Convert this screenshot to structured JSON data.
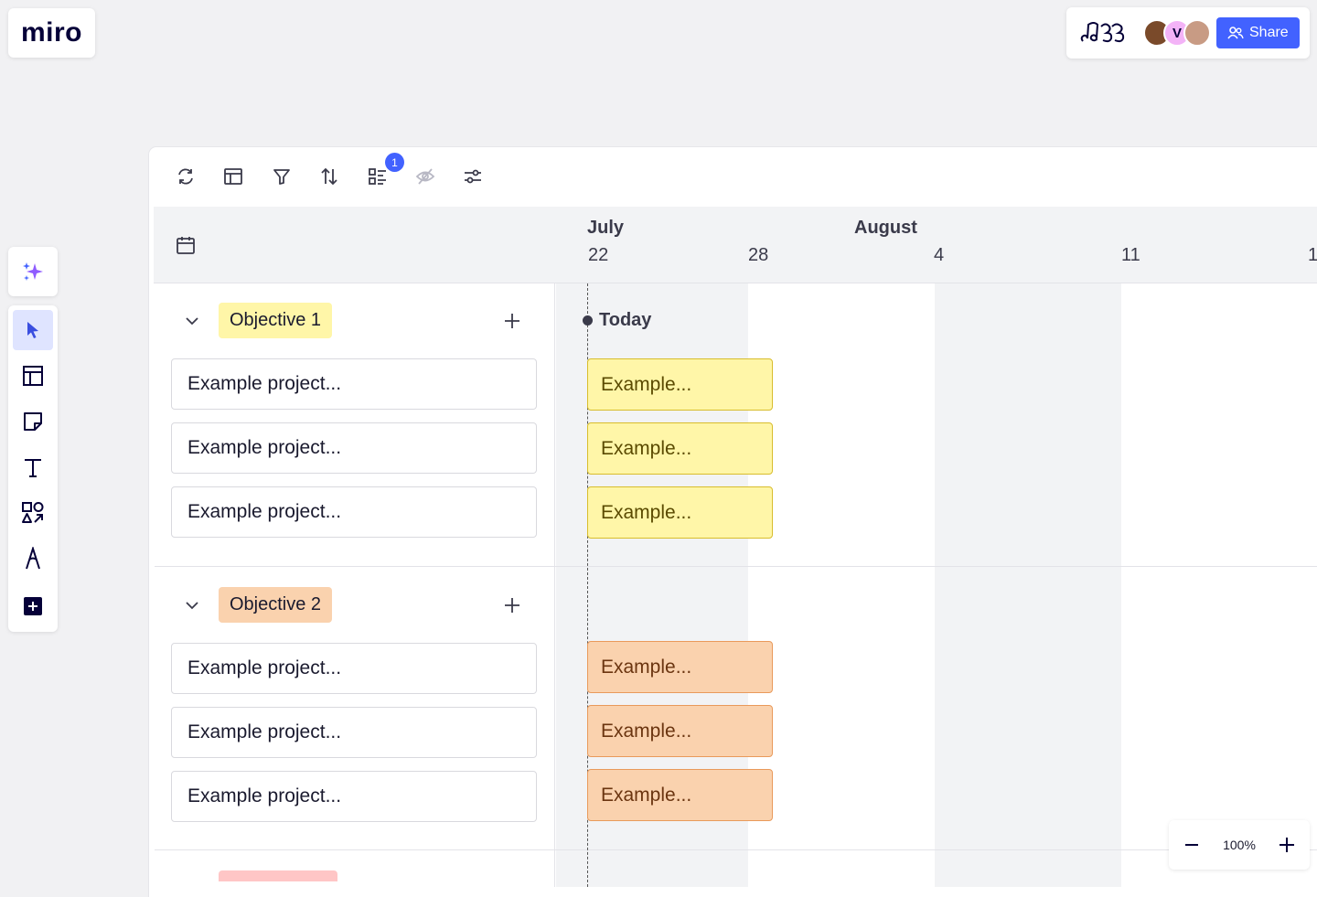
{
  "app": {
    "logo": "miro"
  },
  "header": {
    "share_label": "Share",
    "collaborator_initial": "V"
  },
  "timeline": {
    "months": [
      "July",
      "August"
    ],
    "days": [
      "22",
      "28",
      "4",
      "11",
      "1"
    ],
    "today_label": "Today"
  },
  "objectives": [
    {
      "label": "Objective 1",
      "color": "#fff6a8",
      "projects": [
        "Example project...",
        "Example project...",
        "Example project..."
      ],
      "bars": [
        "Example...",
        "Example...",
        "Example..."
      ]
    },
    {
      "label": "Objective 2",
      "color": "#fad2ae",
      "projects": [
        "Example project...",
        "Example project...",
        "Example project..."
      ],
      "bars": [
        "Example...",
        "Example...",
        "Example..."
      ]
    }
  ],
  "board_toolbar": {
    "filter_badge": "1"
  },
  "zoom": {
    "level": "100%"
  },
  "colors": {
    "accent": "#4262ff",
    "objective3_peek": "#ffc6c6"
  }
}
